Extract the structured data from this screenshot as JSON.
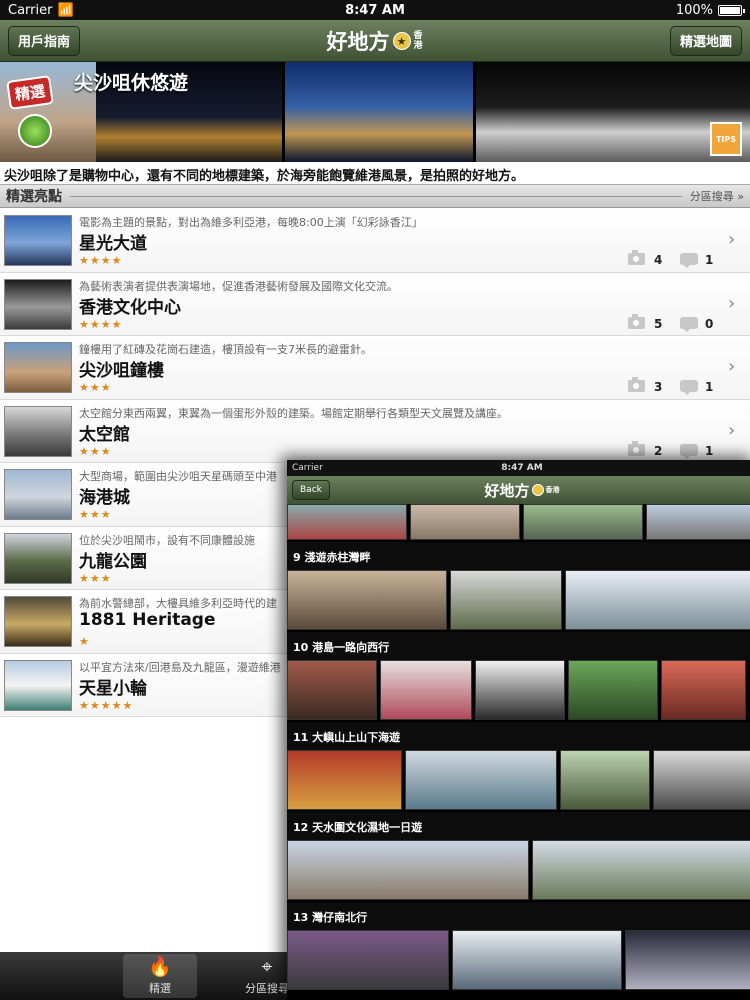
{
  "status_bar": {
    "carrier": "Carrier",
    "time": "8:47 AM",
    "battery": "100%"
  },
  "nav": {
    "left_button": "用戶指南",
    "title": "好地方",
    "title_sub": "香港",
    "right_button": "精選地圖"
  },
  "banner": {
    "badge": "精選",
    "title": "尖沙咀休悠遊",
    "tips": "TIPS"
  },
  "caption": "尖沙咀除了是購物中心，還有不同的地標建築，於海旁能飽覽維港風景，是拍照的好地方。",
  "section": {
    "title": "精選亮點",
    "link": "分區搜尋 »"
  },
  "items": [
    {
      "desc": "電影為主題的景點，對出為維多利亞港，每晚8:00上演「幻彩詠香江」",
      "name": "星光大道",
      "stars": "★★★★",
      "photos": "4",
      "comments": "1"
    },
    {
      "desc": "為藝術表演者提供表演場地，促進香港藝術發展及國際文化交流。",
      "name": "香港文化中心",
      "stars": "★★★★",
      "photos": "5",
      "comments": "0"
    },
    {
      "desc": "鐘樓用了紅磚及花崗石建造，樓頂設有一支7米長的避雷針。",
      "name": "尖沙咀鐘樓",
      "stars": "★★★",
      "photos": "3",
      "comments": "1"
    },
    {
      "desc": "太空館分東西兩翼，東翼為一個蛋形外殼的建築。場館定期舉行各類型天文展覽及講座。",
      "name": "太空館",
      "stars": "★★★",
      "photos": "2",
      "comments": "1"
    },
    {
      "desc": "大型商場，範圍由尖沙咀天星碼頭至中港",
      "name": "海港城",
      "stars": "★★★",
      "photos": "",
      "comments": ""
    },
    {
      "desc": "位於尖沙咀鬧市，設有不同康體設施",
      "name": "九龍公園",
      "stars": "★★★",
      "photos": "",
      "comments": ""
    },
    {
      "desc": "為前水警總部，大樓具維多利亞時代的建",
      "name": "1881 Heritage",
      "stars": "★",
      "photos": "",
      "comments": ""
    },
    {
      "desc": "以平宜方法來/回港島及九龍區，漫遊維港",
      "name": "天星小輪",
      "stars": "★★★★★",
      "photos": "",
      "comments": ""
    }
  ],
  "tabbar": {
    "tab1": "精選",
    "tab2": "分區搜尋"
  },
  "overlay": {
    "status_carrier": "Carrier",
    "status_time": "8:47 AM",
    "back": "Back",
    "title": "好地方",
    "title_sub": "香港",
    "routes": [
      "9 淺遊赤柱灣畔",
      "10 港島一路向西行",
      "11 大嶼山上山下海遊",
      "12 天水圍文化濕地一日遊",
      "13 灣仔南北行"
    ]
  }
}
